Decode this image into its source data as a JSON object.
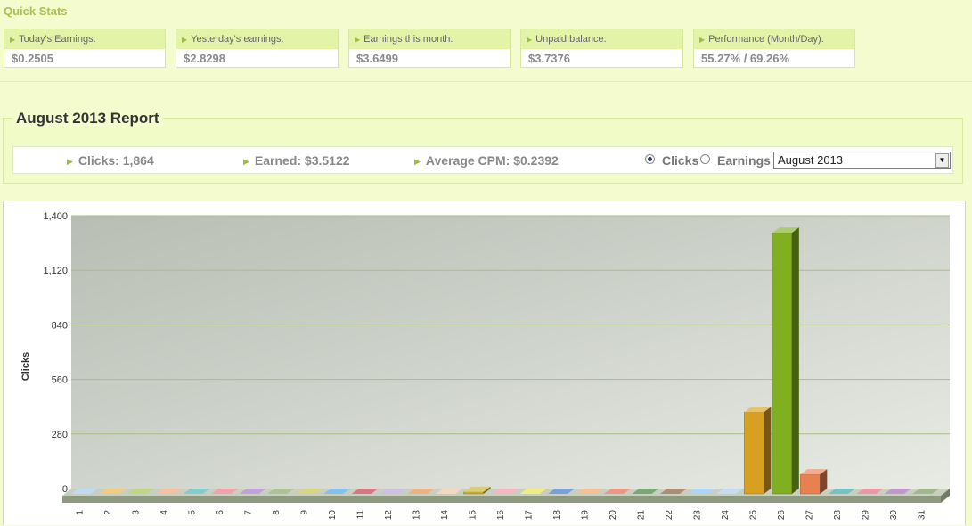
{
  "quick_stats": {
    "title": "Quick Stats",
    "items": [
      {
        "label": "Today's Earnings:",
        "value": "$0.2505"
      },
      {
        "label": "Yesterday's earnings:",
        "value": "$2.8298"
      },
      {
        "label": "Earnings this month:",
        "value": "$3.6499"
      },
      {
        "label": "Unpaid balance:",
        "value": "$3.7376"
      },
      {
        "label": "Performance (Month/Day):",
        "value": "55.27% / 69.26%"
      }
    ]
  },
  "report": {
    "title": "August 2013 Report",
    "clicks": "Clicks: 1,864",
    "earned": "Earned: $3.5122",
    "avg_cpm": "Average CPM: $0.2392",
    "radio_clicks": "Clicks",
    "radio_earnings": "Earnings",
    "selected_radio": "Clicks",
    "month_select": "August 2013"
  },
  "chart_data": {
    "type": "bar",
    "ylabel": "Clicks",
    "xlabel": "",
    "ylim": [
      0,
      1400
    ],
    "yticks": [
      "1,400",
      "1,120",
      "840",
      "560",
      "280",
      "0"
    ],
    "ytick_values": [
      1400,
      1120,
      840,
      560,
      280,
      0
    ],
    "categories": [
      "1",
      "2",
      "3",
      "4",
      "5",
      "6",
      "7",
      "8",
      "9",
      "10",
      "11",
      "12",
      "13",
      "14",
      "15",
      "16",
      "17",
      "18",
      "19",
      "20",
      "21",
      "22",
      "23",
      "24",
      "25",
      "26",
      "27",
      "28",
      "29",
      "30",
      "31"
    ],
    "values": [
      0,
      0,
      0,
      0,
      0,
      0,
      0,
      0,
      0,
      0,
      0,
      0,
      0,
      0,
      10,
      0,
      0,
      0,
      0,
      0,
      0,
      0,
      0,
      0,
      420,
      1340,
      100,
      0,
      0,
      0,
      0
    ],
    "colors": [
      "#9ec8ea",
      "#e8b040",
      "#9cc040",
      "#f0a070",
      "#40b0b0",
      "#e87080",
      "#a070c0",
      "#80a060",
      "#c0c040",
      "#40a0e0",
      "#c03040",
      "#b0a0d0",
      "#e08840",
      "#f0c0a0",
      "#c8b030",
      "#f090a0",
      "#e8e040",
      "#3070c0",
      "#f0a060",
      "#e06040",
      "#307830",
      "#805030",
      "#80c0f0",
      "#a8c8e8",
      "#d8a020",
      "#80b020",
      "#e88050",
      "#30a0a0",
      "#e06070",
      "#a060b0",
      "#709050"
    ]
  }
}
